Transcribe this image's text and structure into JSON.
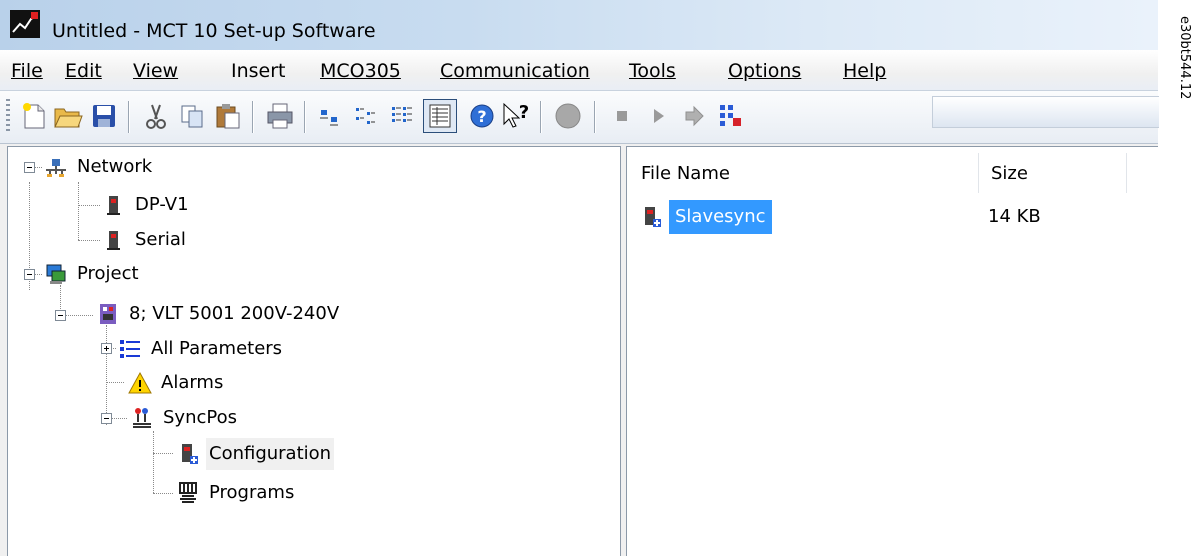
{
  "window": {
    "title": "Untitled - MCT 10 Set-up Software"
  },
  "menu": [
    {
      "label": "File"
    },
    {
      "label": "Edit"
    },
    {
      "label": "View"
    },
    {
      "label": "Insert"
    },
    {
      "label": "MCO305"
    },
    {
      "label": "Communication"
    },
    {
      "label": "Tools"
    },
    {
      "label": "Options"
    },
    {
      "label": "Help"
    }
  ],
  "toolbar": {
    "icons": [
      "new-icon",
      "open-icon",
      "save-icon",
      "cut-icon",
      "copy-icon",
      "paste-icon",
      "print-icon",
      "large-icons-view-icon",
      "small-icons-view-icon",
      "list-view-icon",
      "details-view-icon",
      "help-icon",
      "context-help-icon",
      "connect-icon",
      "stop-icon",
      "play-icon",
      "step-icon",
      "network-scan-icon"
    ],
    "active_view": "details-view-icon"
  },
  "tree": {
    "network": {
      "label": "Network",
      "children": [
        {
          "label": "DP-V1"
        },
        {
          "label": "Serial"
        }
      ]
    },
    "project": {
      "label": "Project",
      "drive": {
        "label": "8; VLT 5001 200V-240V",
        "children": [
          {
            "label": "All Parameters"
          },
          {
            "label": "Alarms"
          },
          {
            "label": "SyncPos",
            "children": [
              {
                "label": "Configuration"
              },
              {
                "label": "Programs"
              }
            ]
          }
        ]
      }
    }
  },
  "filelist": {
    "columns": [
      "File Name",
      "Size"
    ],
    "rows": [
      {
        "name": "Slavesync",
        "size": "14 KB"
      }
    ]
  },
  "figure_id": "e30bt544.12",
  "colors": {
    "selection": "#3399ff",
    "titlebar": "#b9d1ea"
  }
}
